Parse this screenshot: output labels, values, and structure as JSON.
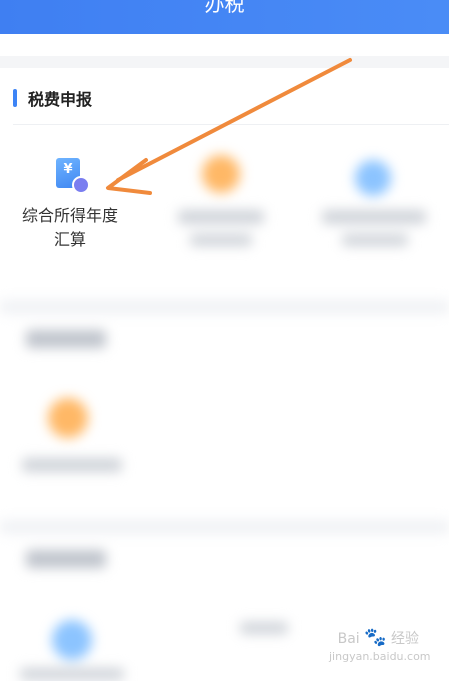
{
  "header": {
    "title": "办税"
  },
  "section": {
    "title": "税费申报"
  },
  "tiles": [
    {
      "label_line1": "综合所得年度",
      "label_line2": "汇算",
      "icon": "tax-document-icon"
    }
  ],
  "watermark": {
    "brand": "Bai",
    "brand_cn": "经验",
    "url": "jingyan.baidu.com"
  },
  "colors": {
    "accent": "#3d84f6",
    "arrow": "#f08a3c",
    "header_bg": "#4186f4"
  }
}
